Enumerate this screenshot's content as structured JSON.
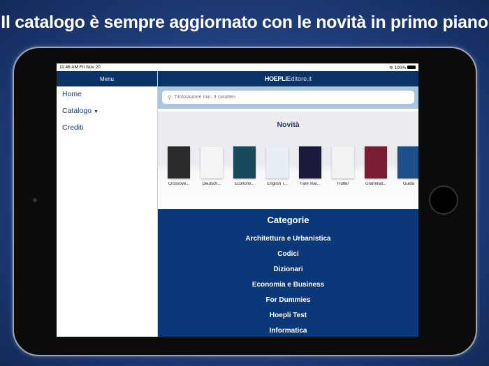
{
  "headline": "Il catalogo è sempre aggiornato con le novità in primo piano",
  "status": {
    "time": "11:46 AM  Fri Nov 20",
    "battery": "100%"
  },
  "sidebar": {
    "title": "Menu",
    "items": [
      {
        "label": "Home"
      },
      {
        "label": "Catalogo"
      },
      {
        "label": "Crediti"
      }
    ]
  },
  "header": {
    "brand_bold": "HOEPLI",
    "brand_light": "Editore.it"
  },
  "search": {
    "placeholder": "Titolo/Autore min. 3 caratteri"
  },
  "novita": {
    "title": "Novità",
    "books": [
      {
        "label": "Crossove...",
        "color": "#2b2b2b"
      },
      {
        "label": "Deutsch...",
        "color": "#f4f4f4"
      },
      {
        "label": "Economi...",
        "color": "#184a5c"
      },
      {
        "label": "English T...",
        "color": "#e8eef6"
      },
      {
        "label": "Fare mar...",
        "color": "#1c1a3a"
      },
      {
        "label": "Flutter",
        "color": "#f2f2f2"
      },
      {
        "label": "Grammat...",
        "color": "#7a1f33"
      },
      {
        "label": "Guida",
        "color": "#1d4f8a"
      }
    ]
  },
  "categorie": {
    "title": "Categorie",
    "items": [
      "Architettura e Urbanistica",
      "Codici",
      "Dizionari",
      "Economia e Business",
      "For Dummies",
      "Hoepli Test",
      "Informatica"
    ]
  }
}
